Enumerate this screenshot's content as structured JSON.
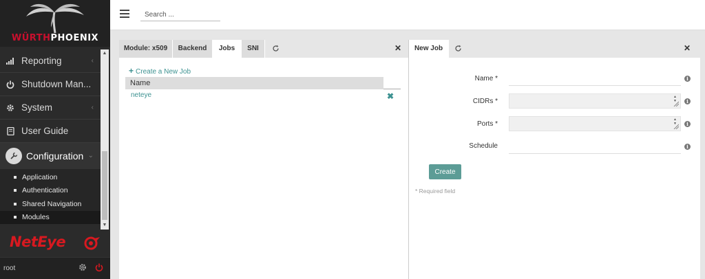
{
  "brand": {
    "company_prefix": "WÜRTH",
    "company_suffix": "PHOENIX",
    "product": "NetEye"
  },
  "sidebar": {
    "items": [
      {
        "label": "Reporting",
        "icon": "bar-chart-icon",
        "has_children": true
      },
      {
        "label": "Shutdown Man...",
        "icon": "power-icon",
        "has_children": false
      },
      {
        "label": "System",
        "icon": "gear-icon",
        "has_children": true
      },
      {
        "label": "User Guide",
        "icon": "book-icon",
        "has_children": false
      },
      {
        "label": "Configuration",
        "icon": "wrench-icon",
        "has_children": true,
        "expanded": true
      }
    ],
    "subitems": [
      {
        "label": "Application",
        "selected": false
      },
      {
        "label": "Authentication",
        "selected": false
      },
      {
        "label": "Shared Navigation",
        "selected": false
      },
      {
        "label": "Modules",
        "selected": true
      }
    ],
    "user": "root"
  },
  "topbar": {
    "search_placeholder": "Search ..."
  },
  "left_panel": {
    "tabs": [
      {
        "label": "Module: x509",
        "active": false
      },
      {
        "label": "Backend",
        "active": false
      },
      {
        "label": "Jobs",
        "active": true
      },
      {
        "label": "SNI",
        "active": false
      }
    ],
    "create_link": "Create a New Job",
    "table": {
      "header": "Name",
      "rows": [
        "neteye"
      ]
    }
  },
  "right_panel": {
    "tabs": [
      {
        "label": "New Job",
        "active": true
      }
    ],
    "fields": [
      {
        "label": "Name *",
        "value": ""
      },
      {
        "label": "CIDRs *",
        "value": ""
      },
      {
        "label": "Ports *",
        "value": ""
      },
      {
        "label": "Schedule",
        "value": ""
      }
    ],
    "create_button": "Create",
    "required_note": "* Required field"
  },
  "colors": {
    "accent": "#3d9291",
    "button": "#5c9c96",
    "brand_red": "#c8102e",
    "sidebar_bg": "#2b2b2b"
  }
}
